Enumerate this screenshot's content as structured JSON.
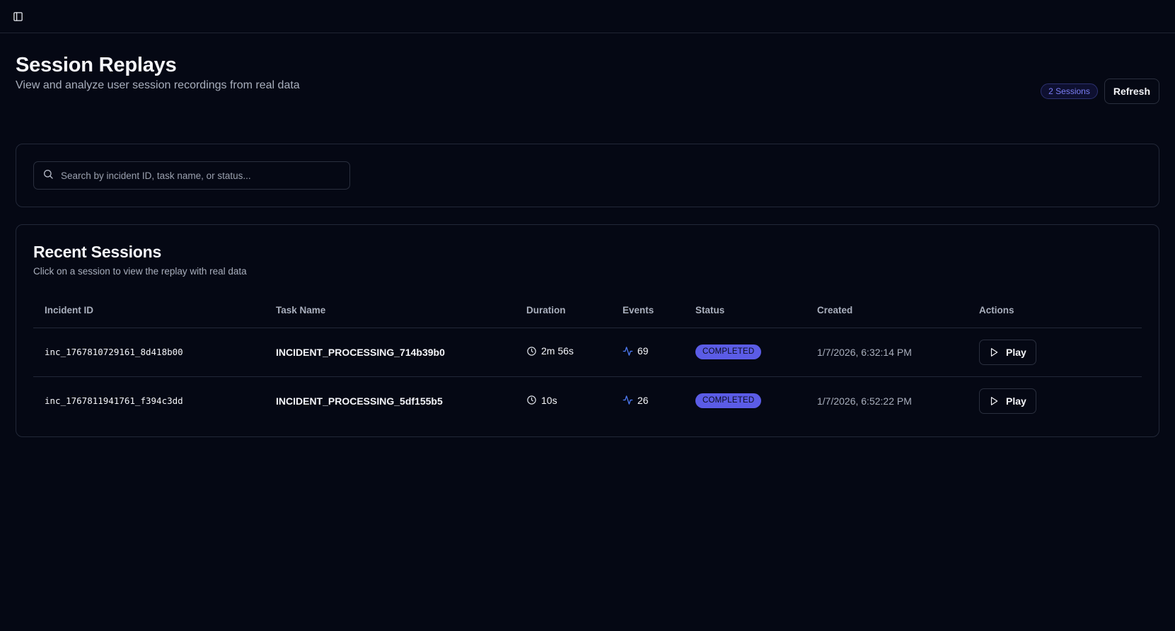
{
  "header": {
    "title": "Session Replays",
    "subtitle": "View and analyze user session recordings from real data",
    "sessions_badge": "2 Sessions",
    "refresh_label": "Refresh"
  },
  "search": {
    "placeholder": "Search by incident ID, task name, or status...",
    "value": ""
  },
  "recent": {
    "title": "Recent Sessions",
    "subtitle": "Click on a session to view the replay with real data",
    "columns": [
      "Incident ID",
      "Task Name",
      "Duration",
      "Events",
      "Status",
      "Created",
      "Actions"
    ],
    "rows": [
      {
        "incident_id": "inc_1767810729161_8d418b00",
        "task_name": "INCIDENT_PROCESSING_714b39b0",
        "duration": "2m 56s",
        "events": "69",
        "status": "COMPLETED",
        "created": "1/7/2026, 6:32:14 PM",
        "action_label": "Play"
      },
      {
        "incident_id": "inc_1767811941761_f394c3dd",
        "task_name": "INCIDENT_PROCESSING_5df155b5",
        "duration": "10s",
        "events": "26",
        "status": "COMPLETED",
        "created": "1/7/2026, 6:52:22 PM",
        "action_label": "Play"
      }
    ]
  },
  "colors": {
    "background": "#050814",
    "accent": "#5b5ce6",
    "events_icon": "#4f7cf7"
  },
  "icons": {
    "sidebar_toggle": "sidebar-toggle-icon",
    "search": "search-icon",
    "duration": "clock-icon",
    "events": "activity-icon",
    "play": "play-icon"
  }
}
